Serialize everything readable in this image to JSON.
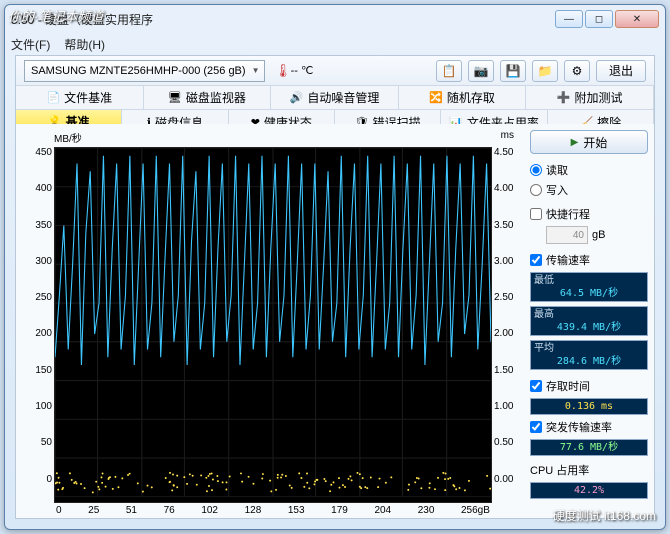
{
  "watermark_left": "你的·笔记本频道",
  "watermark_right": "硬度测试 it168.com",
  "window": {
    "title": "5.50 - 硬盘（硬盘实用程序"
  },
  "menu": {
    "file": "文件(F)",
    "help": "帮助(H)"
  },
  "toolbar": {
    "device": "SAMSUNG MZNTE256HMHP-000 (256 gB)",
    "temp_value": "-- ℃",
    "exit": "退出"
  },
  "tabs_row1": {
    "file_bench": "文件基准",
    "disk_monitor": "磁盘监视器",
    "aam": "自动噪音管理",
    "random": "随机存取",
    "extra": "附加测试"
  },
  "tabs_row2": {
    "benchmark": "基准",
    "disk_info": "磁盘信息",
    "health": "健康状态",
    "error_scan": "错误扫描",
    "folder_usage": "文件夹占用率",
    "erase": "擦除"
  },
  "chart": {
    "ylabel": "MB/秒",
    "y2label": "ms",
    "x_unit": "256gB"
  },
  "chart_data": {
    "type": "line",
    "ylabel": "MB/秒",
    "y2label": "ms",
    "ylim": [
      0,
      450
    ],
    "y2lim": [
      0,
      4.5
    ],
    "y_ticks": [
      0,
      50,
      100,
      150,
      200,
      250,
      300,
      350,
      400,
      450
    ],
    "y2_ticks": [
      0,
      0.5,
      1.0,
      1.5,
      2.0,
      2.5,
      3.0,
      3.5,
      4.0,
      4.5
    ],
    "x_ticks": [
      0,
      25,
      51,
      76,
      102,
      128,
      153,
      179,
      204,
      230
    ],
    "x_unit_label": "256gB",
    "series": [
      {
        "name": "传输速率 (MB/秒)",
        "color": "#3ec6ff",
        "values": [
          180,
          260,
          350,
          190,
          300,
          430,
          170,
          340,
          420,
          210,
          250,
          440,
          180,
          320,
          430,
          190,
          260,
          440,
          170,
          300,
          430,
          190,
          250,
          440,
          180,
          310,
          430,
          200,
          260,
          440,
          170,
          330,
          420,
          190,
          250,
          440,
          180,
          320,
          430,
          200,
          260,
          440,
          170,
          300,
          430,
          190,
          250,
          440,
          180,
          320,
          430,
          200,
          260,
          440,
          180,
          300,
          430,
          190,
          260,
          430,
          190,
          300,
          420,
          200,
          250,
          440,
          180,
          320,
          430,
          190,
          260,
          440,
          180,
          300,
          430,
          190,
          250,
          440,
          180,
          320,
          430,
          190,
          260,
          440,
          170,
          300,
          430,
          200,
          250,
          440,
          180,
          320,
          430,
          210,
          260,
          440,
          190,
          300,
          430,
          200
        ]
      },
      {
        "name": "存取时间 (ms)",
        "color": "#ffe24d",
        "note": "scatter near 0 baseline",
        "approx_value": 0.14
      }
    ]
  },
  "panel": {
    "start": "开始",
    "read": "读取",
    "write": "写入",
    "short_stroke": "快捷行程",
    "short_stroke_val": "40",
    "short_stroke_unit": "gB",
    "transfer_rate": "传输速率",
    "min_lbl": "最低",
    "min_val": "64.5 MB/秒",
    "max_lbl": "最高",
    "max_val": "439.4 MB/秒",
    "avg_lbl": "平均",
    "avg_val": "284.6 MB/秒",
    "access_time": "存取时间",
    "access_val": "0.136 ms",
    "burst": "突发传输速率",
    "burst_val": "77.6 MB/秒",
    "cpu_lbl": "CPU 占用率",
    "cpu_val": "42.2%"
  }
}
